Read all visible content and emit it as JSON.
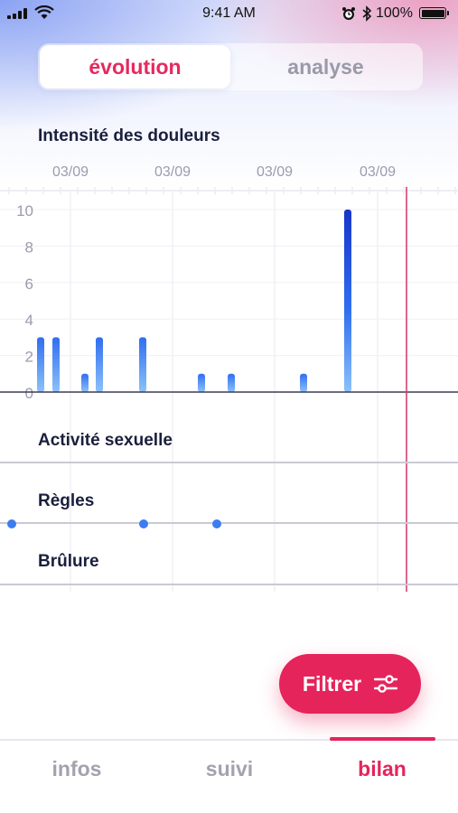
{
  "status_bar": {
    "time": "9:41 AM",
    "battery": "100%"
  },
  "segmented": {
    "active": "évolution",
    "inactive": "analyse"
  },
  "sections": {
    "pain": "Intensité des douleurs",
    "sexual": "Activité sexuelle",
    "periods": "Règles",
    "burn": "Brûlure"
  },
  "date_labels": [
    "03/09",
    "03/09",
    "03/09",
    "03/09"
  ],
  "chart_data": {
    "type": "bar",
    "title": "Intensité des douleurs",
    "xlabel": "",
    "ylabel": "",
    "ylim": [
      0,
      10
    ],
    "yticks": [
      0,
      2,
      4,
      6,
      8,
      10
    ],
    "grid": true,
    "values": [
      3,
      3,
      1,
      3,
      3,
      1,
      1,
      1,
      10
    ]
  },
  "colors": {
    "accent": "#e5245c",
    "bar_top": "#2f6ef0",
    "bar_bottom": "#8cc1fa",
    "bar_peak": "#1836c9",
    "dot": "#3d7df2"
  },
  "periods_dots": 3,
  "filter_button": {
    "label": "Filtrer",
    "icon": "sliders-icon"
  },
  "tabs": [
    {
      "label": "infos",
      "active": false
    },
    {
      "label": "suivi",
      "active": false
    },
    {
      "label": "bilan",
      "active": true
    }
  ]
}
